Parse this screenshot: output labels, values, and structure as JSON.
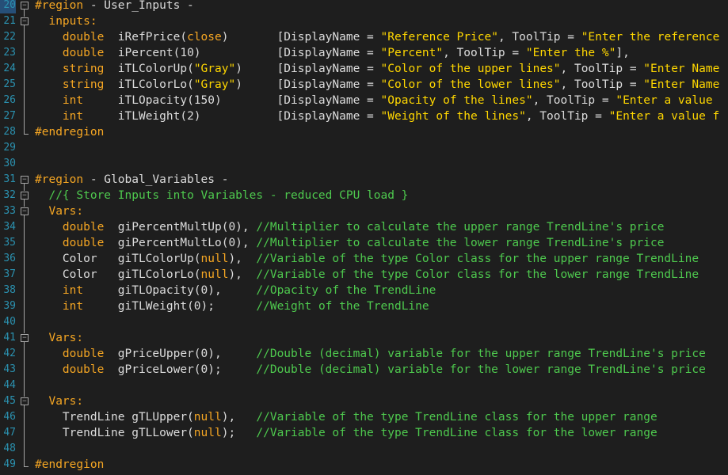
{
  "colors": {
    "default": "#dcdcdc",
    "keyword": "#f5a623",
    "string": "#ffd700",
    "comment": "#4ec94e",
    "linenum": "#2b91af",
    "background": "#1e1e1e"
  },
  "lines": [
    {
      "num": "20",
      "fold": "box-minus",
      "tokens": [
        [
          "#region",
          "kw"
        ],
        [
          " - User_Inputs -",
          "d"
        ]
      ]
    },
    {
      "num": "21",
      "fold": "box-minus",
      "tokens": [
        [
          "  inputs:",
          "kw"
        ]
      ]
    },
    {
      "num": "22",
      "fold": "line",
      "tokens": [
        [
          "    ",
          "d"
        ],
        [
          "double",
          "kw"
        ],
        [
          "  iRefPrice(",
          "d"
        ],
        [
          "close",
          "kw"
        ],
        [
          ")       [DisplayName = ",
          "d"
        ],
        [
          "\"Reference Price\"",
          "str"
        ],
        [
          ", ToolTip = ",
          "d"
        ],
        [
          "\"Enter the reference",
          "str"
        ]
      ]
    },
    {
      "num": "23",
      "fold": "line",
      "tokens": [
        [
          "    ",
          "d"
        ],
        [
          "double",
          "kw"
        ],
        [
          "  iPercent(10)           [DisplayName = ",
          "d"
        ],
        [
          "\"Percent\"",
          "str"
        ],
        [
          ", ToolTip = ",
          "d"
        ],
        [
          "\"Enter the %\"",
          "str"
        ],
        [
          "],",
          "d"
        ]
      ]
    },
    {
      "num": "24",
      "fold": "line",
      "tokens": [
        [
          "    ",
          "d"
        ],
        [
          "string",
          "kw"
        ],
        [
          "  iTLColorUp(",
          "d"
        ],
        [
          "\"Gray\"",
          "str"
        ],
        [
          ")     [DisplayName = ",
          "d"
        ],
        [
          "\"Color of the upper lines\"",
          "str"
        ],
        [
          ", ToolTip = ",
          "d"
        ],
        [
          "\"Enter Name",
          "str"
        ]
      ]
    },
    {
      "num": "25",
      "fold": "line",
      "tokens": [
        [
          "    ",
          "d"
        ],
        [
          "string",
          "kw"
        ],
        [
          "  iTLColorLo(",
          "d"
        ],
        [
          "\"Gray\"",
          "str"
        ],
        [
          ")     [DisplayName = ",
          "d"
        ],
        [
          "\"Color of the lower lines\"",
          "str"
        ],
        [
          ", ToolTip = ",
          "d"
        ],
        [
          "\"Enter Name",
          "str"
        ]
      ]
    },
    {
      "num": "26",
      "fold": "line",
      "tokens": [
        [
          "    ",
          "d"
        ],
        [
          "int",
          "kw"
        ],
        [
          "     iTLOpacity(150)        [DisplayName = ",
          "d"
        ],
        [
          "\"Opacity of the lines\"",
          "str"
        ],
        [
          ", ToolTip = ",
          "d"
        ],
        [
          "\"Enter a value ",
          "str"
        ]
      ]
    },
    {
      "num": "27",
      "fold": "line-end",
      "tokens": [
        [
          "    ",
          "d"
        ],
        [
          "int",
          "kw"
        ],
        [
          "     iTLWeight(2)           [DisplayName = ",
          "d"
        ],
        [
          "\"Weight of the lines\"",
          "str"
        ],
        [
          ", ToolTip = ",
          "d"
        ],
        [
          "\"Enter a value f",
          "str"
        ]
      ]
    },
    {
      "num": "28",
      "fold": "end",
      "tokens": [
        [
          "#endregion",
          "kw"
        ]
      ]
    },
    {
      "num": "29",
      "fold": "",
      "tokens": []
    },
    {
      "num": "30",
      "fold": "",
      "tokens": []
    },
    {
      "num": "31",
      "fold": "box-minus",
      "tokens": [
        [
          "#region",
          "kw"
        ],
        [
          " - Global_Variables -",
          "d"
        ]
      ]
    },
    {
      "num": "32",
      "fold": "box-minus",
      "tokens": [
        [
          "  ",
          "d"
        ],
        [
          "//{ Store Inputs into Variables - reduced CPU load }",
          "com"
        ]
      ]
    },
    {
      "num": "33",
      "fold": "box-minus",
      "tokens": [
        [
          "  ",
          "d"
        ],
        [
          "Vars:",
          "kw"
        ]
      ]
    },
    {
      "num": "34",
      "fold": "line",
      "tokens": [
        [
          "    ",
          "d"
        ],
        [
          "double",
          "kw"
        ],
        [
          "  giPercentMultUp(0), ",
          "d"
        ],
        [
          "//Multiplier to calculate the upper range TrendLine's price",
          "com"
        ]
      ]
    },
    {
      "num": "35",
      "fold": "line",
      "tokens": [
        [
          "    ",
          "d"
        ],
        [
          "double",
          "kw"
        ],
        [
          "  giPercentMultLo(0), ",
          "d"
        ],
        [
          "//Multiplier to calculate the lower range TrendLine's price",
          "com"
        ]
      ]
    },
    {
      "num": "36",
      "fold": "line",
      "tokens": [
        [
          "    Color   giTLColorUp(",
          "d"
        ],
        [
          "null",
          "kw"
        ],
        [
          "),  ",
          "d"
        ],
        [
          "//Variable of the type Color class for the upper range TrendLine",
          "com"
        ]
      ]
    },
    {
      "num": "37",
      "fold": "line",
      "tokens": [
        [
          "    Color   giTLColorLo(",
          "d"
        ],
        [
          "null",
          "kw"
        ],
        [
          "),  ",
          "d"
        ],
        [
          "//Variable of the type Color class for the lower range TrendLine",
          "com"
        ]
      ]
    },
    {
      "num": "38",
      "fold": "line",
      "tokens": [
        [
          "    ",
          "d"
        ],
        [
          "int",
          "kw"
        ],
        [
          "     giTLOpacity(0),     ",
          "d"
        ],
        [
          "//Opacity of the TrendLine",
          "com"
        ]
      ]
    },
    {
      "num": "39",
      "fold": "line-end",
      "tokens": [
        [
          "    ",
          "d"
        ],
        [
          "int",
          "kw"
        ],
        [
          "     giTLWeight(0);      ",
          "d"
        ],
        [
          "//Weight of the TrendLine",
          "com"
        ]
      ]
    },
    {
      "num": "40",
      "fold": "line",
      "tokens": []
    },
    {
      "num": "41",
      "fold": "box-minus",
      "tokens": [
        [
          "  ",
          "d"
        ],
        [
          "Vars:",
          "kw"
        ]
      ]
    },
    {
      "num": "42",
      "fold": "line",
      "tokens": [
        [
          "    ",
          "d"
        ],
        [
          "double",
          "kw"
        ],
        [
          "  gPriceUpper(0),     ",
          "d"
        ],
        [
          "//Double (decimal) variable for the upper range TrendLine's price",
          "com"
        ]
      ]
    },
    {
      "num": "43",
      "fold": "line-end",
      "tokens": [
        [
          "    ",
          "d"
        ],
        [
          "double",
          "kw"
        ],
        [
          "  gPriceLower(0);     ",
          "d"
        ],
        [
          "//Double (decimal) variable for the lower range TrendLine's price",
          "com"
        ]
      ]
    },
    {
      "num": "44",
      "fold": "line",
      "tokens": []
    },
    {
      "num": "45",
      "fold": "box-minus",
      "tokens": [
        [
          "  ",
          "d"
        ],
        [
          "Vars:",
          "kw"
        ]
      ]
    },
    {
      "num": "46",
      "fold": "line",
      "tokens": [
        [
          "    TrendLine gTLUpper(",
          "d"
        ],
        [
          "null",
          "kw"
        ],
        [
          "),   ",
          "d"
        ],
        [
          "//Variable of the type TrendLine class for the upper range",
          "com"
        ]
      ]
    },
    {
      "num": "47",
      "fold": "line-end",
      "tokens": [
        [
          "    TrendLine gTLLower(",
          "d"
        ],
        [
          "null",
          "kw"
        ],
        [
          ");   ",
          "d"
        ],
        [
          "//Variable of the type TrendLine class for the lower range",
          "com"
        ]
      ]
    },
    {
      "num": "48",
      "fold": "line",
      "tokens": []
    },
    {
      "num": "49",
      "fold": "end",
      "tokens": [
        [
          "#endregion",
          "kw"
        ]
      ]
    }
  ]
}
